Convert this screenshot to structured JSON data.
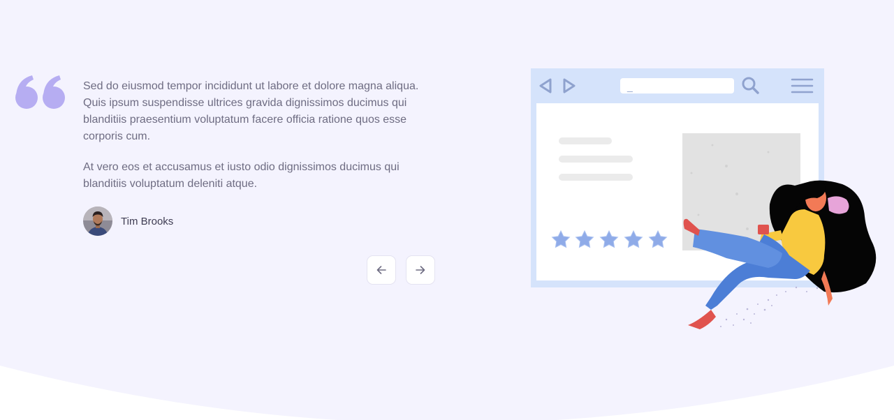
{
  "testimonial": {
    "paragraphs": [
      "Sed do eiusmod tempor incididunt ut labore et dolore magna aliqua. Quis ipsum suspendisse ultrices gravida dignissimos ducimus qui blanditiis praesentium voluptatum facere officia ratione quos esse corporis cum.",
      "At vero eos et accusamus et iusto odio dignissimos ducimus qui blanditiis voluptatum deleniti atque."
    ],
    "author": {
      "name": "Tim Brooks"
    }
  },
  "icons": {
    "quote": "quote-icon",
    "prev": "arrow-left-icon",
    "next": "arrow-right-icon"
  },
  "illustration": {
    "search_text": "_",
    "rating": 5
  },
  "colors": {
    "background": "#f4f3fe",
    "accent": "#b6adf2",
    "text": "#6e6c82",
    "heading": "#3e3c52"
  }
}
